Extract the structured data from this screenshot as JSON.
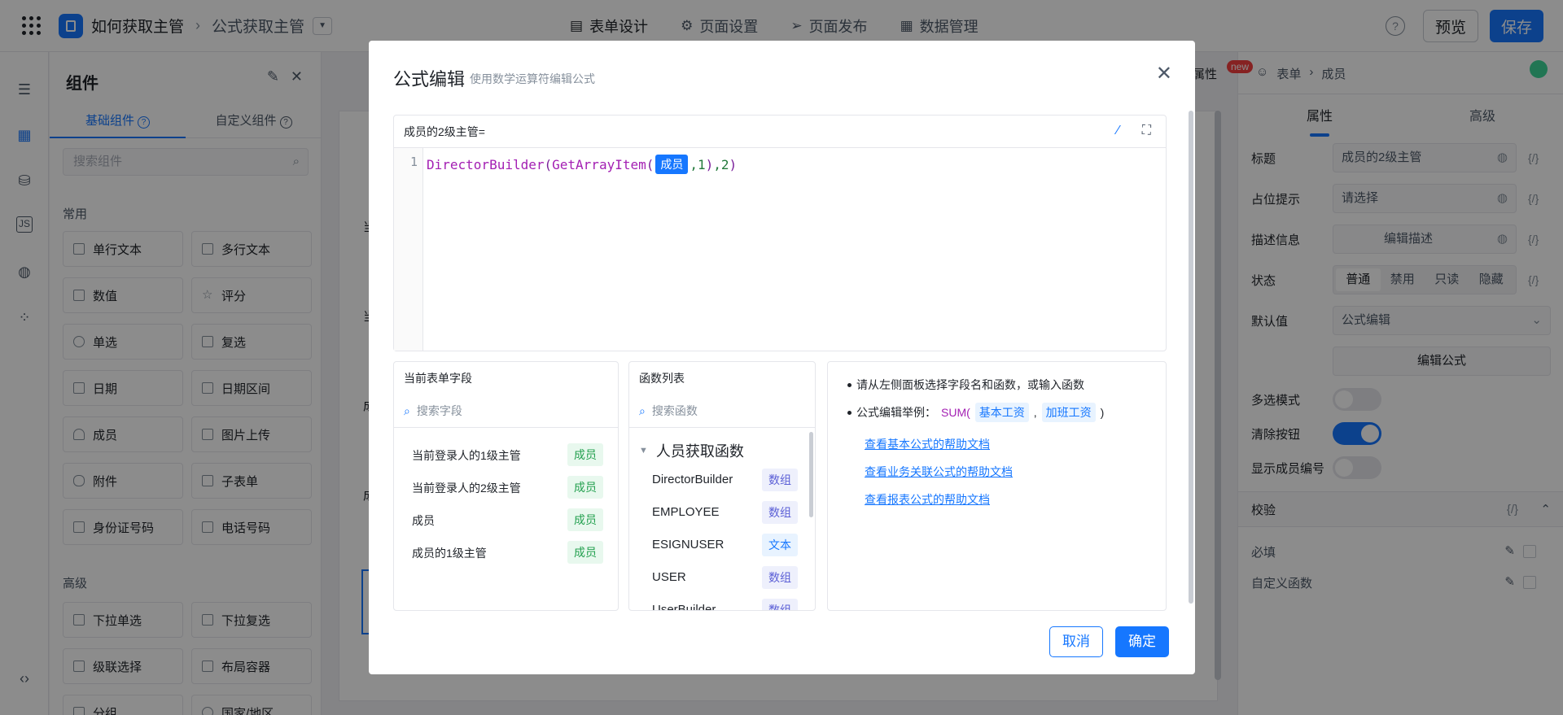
{
  "topbar": {
    "app_name": "如何获取主管",
    "form_name": "公式获取主管",
    "tabs": [
      {
        "label": "表单设计",
        "icon": "document-icon"
      },
      {
        "label": "页面设置",
        "icon": "gear-icon"
      },
      {
        "label": "页面发布",
        "icon": "send-icon"
      },
      {
        "label": "数据管理",
        "icon": "table-icon"
      }
    ],
    "preview_label": "预览",
    "save_label": "保存",
    "help_icon": "?"
  },
  "components": {
    "title": "组件",
    "tabs": [
      "基础组件",
      "自定义组件"
    ],
    "search_placeholder": "搜索组件",
    "group_common": "常用",
    "common_items": [
      "单行文本",
      "多行文本",
      "数值",
      "评分",
      "单选",
      "复选",
      "日期",
      "日期区间",
      "成员",
      "图片上传",
      "附件",
      "子表单",
      "身份证号码",
      "电话号码"
    ],
    "group_advanced": "高级",
    "advanced_items": [
      "下拉单选",
      "下拉复选",
      "级联选择",
      "布局容器",
      "分组",
      "国家/地区"
    ]
  },
  "canvas": {
    "labels": [
      "当",
      "当",
      "成",
      "成"
    ]
  },
  "right_panel": {
    "prop_tab": "属性",
    "new_badge": "new",
    "crumb": [
      "表单",
      "成员"
    ],
    "tabs": [
      "属性",
      "高级"
    ],
    "title_label": "标题",
    "title_value": "成员的2级主管",
    "placeholder_label": "占位提示",
    "placeholder_value": "请选择",
    "desc_label": "描述信息",
    "desc_button": "编辑描述",
    "status_label": "状态",
    "status_options": [
      "普通",
      "禁用",
      "只读",
      "隐藏"
    ],
    "default_label": "默认值",
    "default_value": "公式编辑",
    "edit_formula_button": "编辑公式",
    "multi_label": "多选模式",
    "clear_label": "清除按钮",
    "show_no_label": "显示成员编号",
    "validation_label": "校验",
    "required_label": "必填",
    "custom_fn_label": "自定义函数",
    "fx": "{/}"
  },
  "modal": {
    "title": "公式编辑",
    "subtitle": "使用数学运算符编辑公式",
    "editor_field": "成员的2级主管=",
    "line_number": "1",
    "code": {
      "fn1": "DirectorBuilder",
      "open1": "(",
      "fn2": "GetArrayItem",
      "open2": "(",
      "chip": "成员",
      "arg1": ",1",
      "close2": ")",
      "arg2": ",2",
      "close1": ")"
    },
    "fields_title": "当前表单字段",
    "fields_search": "搜索字段",
    "fields": [
      {
        "name": "当前登录人的1级主管",
        "type": "成员"
      },
      {
        "name": "当前登录人的2级主管",
        "type": "成员"
      },
      {
        "name": "成员",
        "type": "成员"
      },
      {
        "name": "成员的1级主管",
        "type": "成员"
      }
    ],
    "functions_title": "函数列表",
    "functions_search": "搜索函数",
    "function_group": "人员获取函数",
    "functions": [
      {
        "name": "DirectorBuilder",
        "type": "数组"
      },
      {
        "name": "EMPLOYEE",
        "type": "数组"
      },
      {
        "name": "ESIGNUSER",
        "type": "文本"
      },
      {
        "name": "USER",
        "type": "数组"
      },
      {
        "name": "UserBuilder",
        "type": "数组"
      }
    ],
    "help_tip1": "请从左侧面板选择字段名和函数，或输入函数",
    "help_tip2_prefix": "公式编辑举例：",
    "help_tip2_fn": "SUM(",
    "help_tip2_a": "基本工资",
    "help_tip2_comma": ",",
    "help_tip2_b": "加班工资",
    "help_tip2_close": ")",
    "help_links": [
      "查看基本公式的帮助文档",
      "查看业务关联公式的帮助文档",
      "查看报表公式的帮助文档"
    ],
    "cancel_label": "取消",
    "ok_label": "确定"
  }
}
